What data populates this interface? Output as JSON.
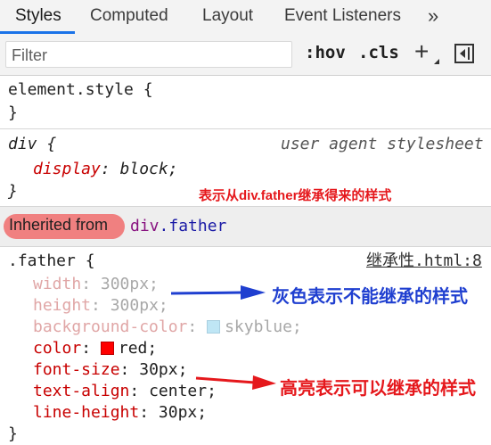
{
  "tabs": {
    "styles": "Styles",
    "computed": "Computed",
    "layout": "Layout",
    "event_listeners": "Event Listeners",
    "more": "»"
  },
  "toolbar": {
    "filter_placeholder": "Filter",
    "hov": ":hov",
    "cls": ".cls",
    "plus": "+"
  },
  "element_style": {
    "selector": "element.style {",
    "close": "}"
  },
  "ua_rule": {
    "selector": "div {",
    "source": "user agent stylesheet",
    "property": "display",
    "value": "block;",
    "close": "}"
  },
  "inherited": {
    "label": "Inherited from",
    "tag": "div",
    "class": ".father"
  },
  "father_rule": {
    "selector": ".father {",
    "source": "继承性.html:8",
    "declarations": [
      {
        "prop": "width",
        "value": "300px;",
        "inherited": false
      },
      {
        "prop": "height",
        "value": "300px;",
        "inherited": false
      },
      {
        "prop": "background-color",
        "value": "skyblue;",
        "inherited": false,
        "swatch": "#87ceeb"
      },
      {
        "prop": "color",
        "value": "red;",
        "inherited": true,
        "swatch": "#ff0000"
      },
      {
        "prop": "font-size",
        "value": "30px;",
        "inherited": true
      },
      {
        "prop": "text-align",
        "value": "center;",
        "inherited": true
      },
      {
        "prop": "line-height",
        "value": "30px;",
        "inherited": true
      }
    ],
    "close": "}"
  },
  "annotations": {
    "inherit_source": "表示从div.father继承得来的样式",
    "gray_note": "灰色表示不能继承的样式",
    "highlight_note": "高亮表示可以继承的样式"
  },
  "colors": {
    "accent_tab": "#1a73e8",
    "annot_red": "#e5181c",
    "annot_blue": "#1f3fd0",
    "pill": "#f08080"
  }
}
